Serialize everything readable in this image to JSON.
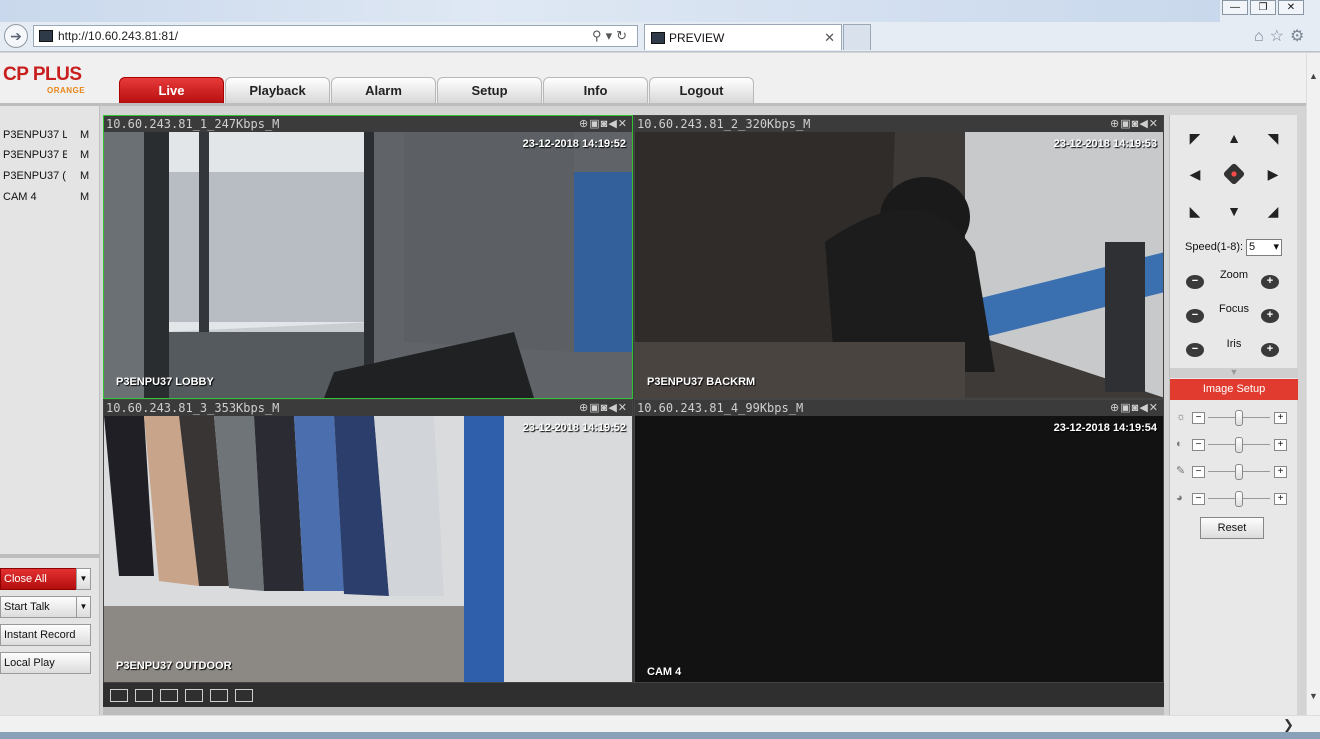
{
  "browser": {
    "address_url": "http://10.60.243.81:81/",
    "tab_title": "PREVIEW",
    "window_buttons": [
      "—",
      "❐",
      "✕"
    ],
    "toolbar_icons": [
      "home-icon",
      "star-icon",
      "gear-icon"
    ]
  },
  "brand": {
    "name": "CP PLUS",
    "sub": "ORANGE",
    "color": "#c81e1e"
  },
  "nav": {
    "tabs": [
      {
        "label": "Live",
        "active": true
      },
      {
        "label": "Playback"
      },
      {
        "label": "Alarm"
      },
      {
        "label": "Setup"
      },
      {
        "label": "Info"
      },
      {
        "label": "Logout"
      }
    ]
  },
  "cameras": [
    {
      "name": "P3ENPU37 L",
      "stream": "M"
    },
    {
      "name": "P3ENPU37 E",
      "stream": "M"
    },
    {
      "name": "P3ENPU37 (",
      "stream": "M"
    },
    {
      "name": "CAM 4",
      "stream": "M"
    }
  ],
  "left_buttons": {
    "close_all": "Close All",
    "start_talk": "Start Talk",
    "instant_record": "Instant Record",
    "local_play": "Local Play"
  },
  "panes": [
    {
      "title": "10.60.243.81_1_247Kbps_M",
      "timestamp": "23-12-2018 14:19:52",
      "camera_label": "P3ENPU37 LOBBY",
      "selected": true
    },
    {
      "title": "10.60.243.81_2_320Kbps_M",
      "timestamp": "23-12-2018 14:19:53",
      "camera_label": "P3ENPU37 BACKRM"
    },
    {
      "title": "10.60.243.81_3_353Kbps_M",
      "timestamp": "23-12-2018 14:19:52",
      "camera_label": "P3ENPU37 OUTDOOR"
    },
    {
      "title": "10.60.243.81_4_99Kbps_M",
      "timestamp": "23-12-2018 14:19:54",
      "camera_label": "CAM 4"
    }
  ],
  "pane_tool_icons": [
    "zoom-in-icon",
    "record-icon",
    "snapshot-icon",
    "audio-icon",
    "close-icon"
  ],
  "ptz": {
    "speed_label": "Speed(1-8):",
    "speed_value": "5",
    "zoom_label": "Zoom",
    "focus_label": "Focus",
    "iris_label": "Iris"
  },
  "image_setup": {
    "title": "Image Setup",
    "sliders": [
      {
        "icon": "brightness-icon",
        "value": 0.5
      },
      {
        "icon": "contrast-icon",
        "value": 0.5
      },
      {
        "icon": "saturation-icon",
        "value": 0.5
      },
      {
        "icon": "hue-icon",
        "value": 0.5
      }
    ],
    "reset_label": "Reset"
  }
}
